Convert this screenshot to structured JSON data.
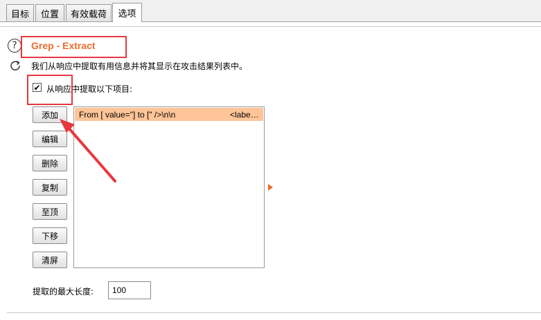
{
  "tabs": [
    {
      "label": "目标",
      "active": false
    },
    {
      "label": "位置",
      "active": false
    },
    {
      "label": "有效载荷",
      "active": false
    },
    {
      "label": "选项",
      "active": true
    }
  ],
  "section": {
    "help_icon": "question-circle-icon",
    "refresh_icon": "refresh-icon",
    "title": "Grep - Extract",
    "description": "我们从响应中提取有用信息并将其显示在攻击结果列表中。",
    "checkbox_label": "从响应中提取以下项目:",
    "checkbox_checked": true,
    "checkbox_mark": "✔"
  },
  "buttons": {
    "add": "添加",
    "edit": "编辑",
    "remove": "删除",
    "duplicate": "复制",
    "up": "至顶",
    "down": "下移",
    "clear": "清屏"
  },
  "items": [
    {
      "expression": "From [ value=\"] to [\" />\\n\\n",
      "label": "<labe…",
      "selected": true
    }
  ],
  "max_length": {
    "label": "提取的最大长度:",
    "value": "100"
  },
  "colors": {
    "title": "#f06b2a",
    "selected_row": "#ffc599",
    "annotation": "#e8373f"
  }
}
